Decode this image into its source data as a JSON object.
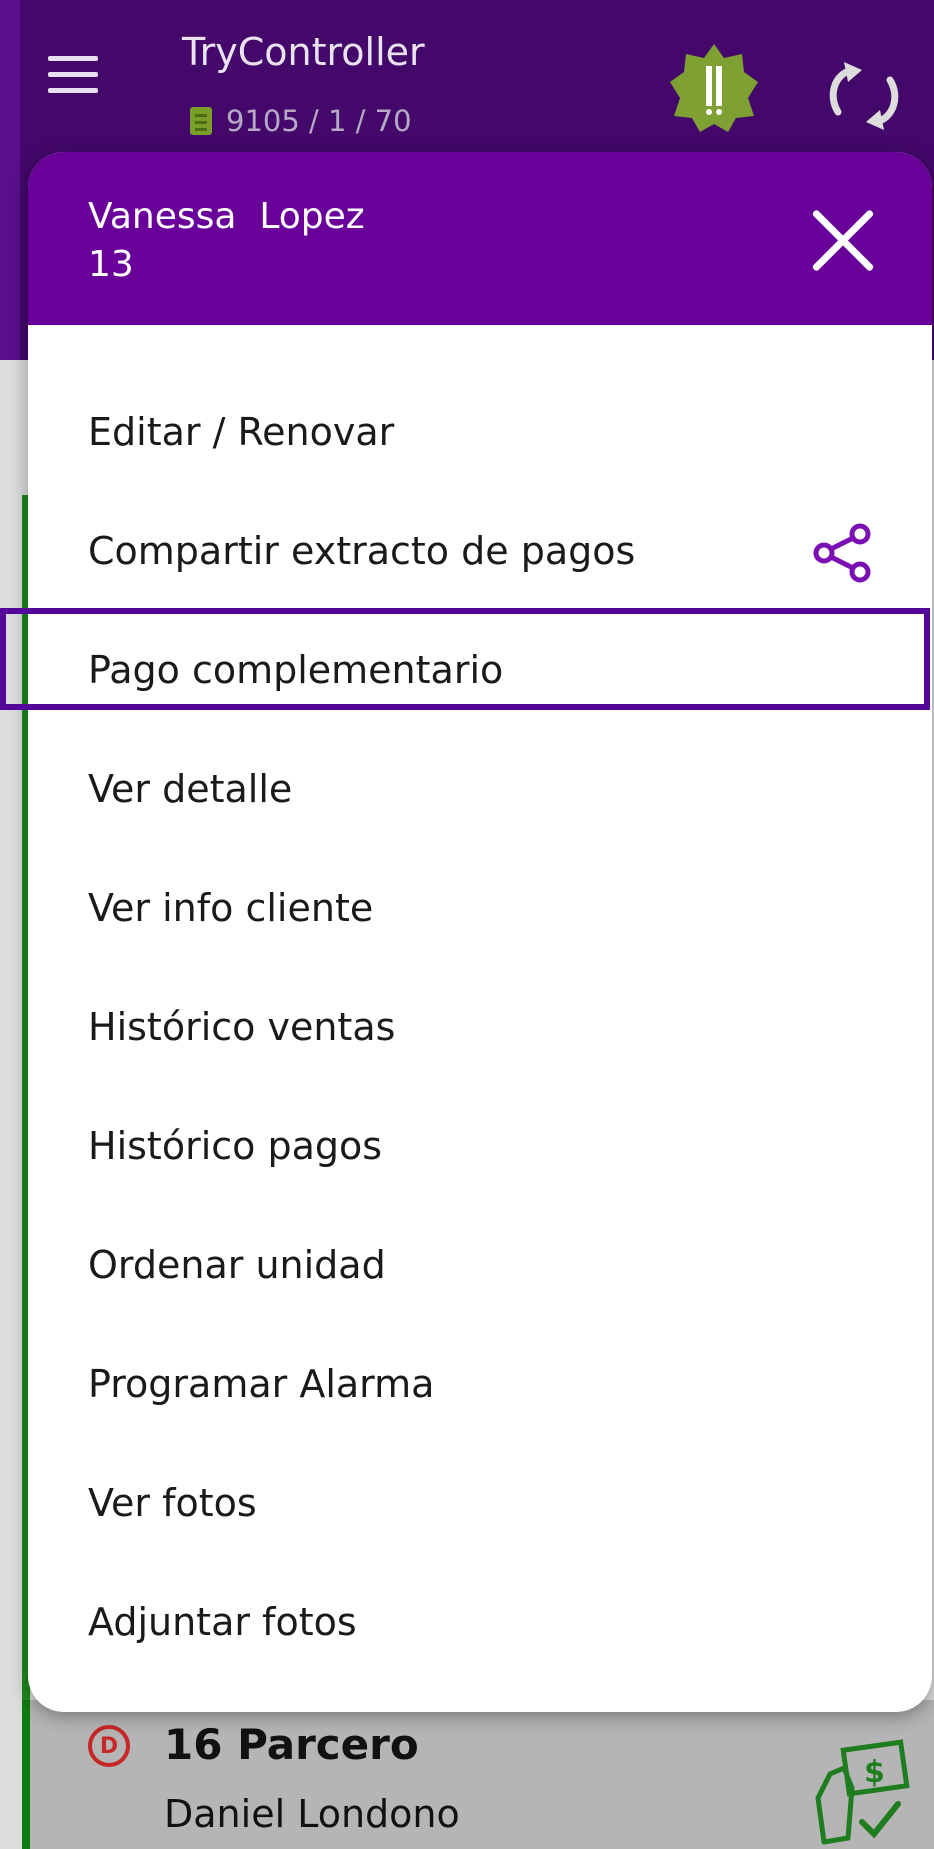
{
  "appbar": {
    "title": "TryController",
    "subtitle": "9105 / 1 / 70"
  },
  "dialog": {
    "client_name": "Vanessa  Lopez",
    "client_number": "13",
    "menu_items": [
      {
        "label": "Editar / Renovar"
      },
      {
        "label": "Compartir extracto de pagos",
        "icon": "share-icon"
      },
      {
        "label": "Pago complementario"
      },
      {
        "label": "Ver detalle"
      },
      {
        "label": "Ver info cliente"
      },
      {
        "label": "Histórico ventas"
      },
      {
        "label": "Histórico pagos"
      },
      {
        "label": "Ordenar unidad"
      },
      {
        "label": "Programar Alarma"
      },
      {
        "label": "Ver fotos"
      },
      {
        "label": "Adjuntar fotos"
      }
    ]
  },
  "list": {
    "visible_row": {
      "badge": "D",
      "title": "16 Parcero",
      "subtitle": "Daniel  Londono"
    }
  },
  "colors": {
    "appbar": "#44086b",
    "dialog_header": "#680099",
    "accent_purple": "#7a0fb3",
    "green": "#1d8a1d"
  }
}
